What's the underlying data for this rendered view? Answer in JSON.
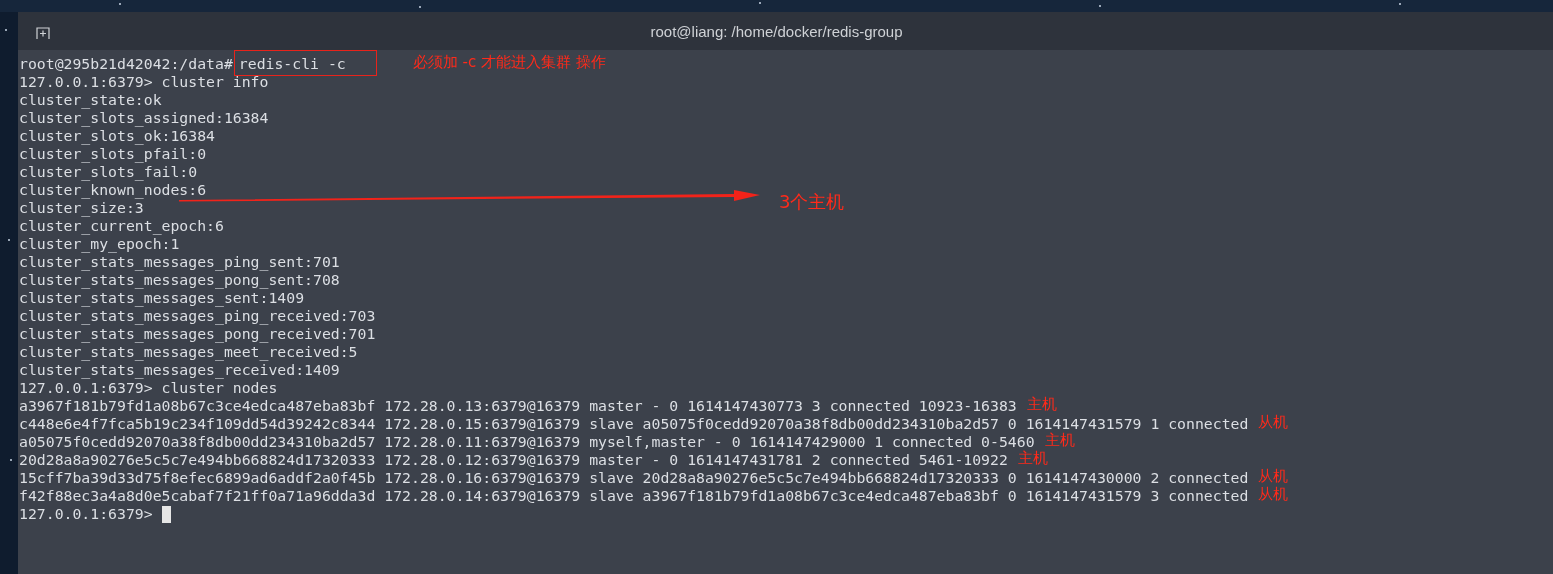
{
  "window": {
    "title": "root@liang: /home/docker/redis-group"
  },
  "lines": [
    {
      "kind": "command",
      "prompt": "root@295b21d42042:/data#",
      "command": "redis-cli -c",
      "highlighted": true,
      "note": "必须加 -c 才能进入集群 操作"
    },
    {
      "kind": "text",
      "text": "127.0.0.1:6379> cluster info"
    },
    {
      "kind": "text",
      "text": "cluster_state:ok"
    },
    {
      "kind": "text",
      "text": "cluster_slots_assigned:16384"
    },
    {
      "kind": "text",
      "text": "cluster_slots_ok:16384"
    },
    {
      "kind": "text",
      "text": "cluster_slots_pfail:0"
    },
    {
      "kind": "text",
      "text": "cluster_slots_fail:0"
    },
    {
      "kind": "text",
      "text": "cluster_known_nodes:6",
      "arrow_note": "3个主机"
    },
    {
      "kind": "text",
      "text": "cluster_size:3"
    },
    {
      "kind": "text",
      "text": "cluster_current_epoch:6"
    },
    {
      "kind": "text",
      "text": "cluster_my_epoch:1"
    },
    {
      "kind": "text",
      "text": "cluster_stats_messages_ping_sent:701"
    },
    {
      "kind": "text",
      "text": "cluster_stats_messages_pong_sent:708"
    },
    {
      "kind": "text",
      "text": "cluster_stats_messages_sent:1409"
    },
    {
      "kind": "text",
      "text": "cluster_stats_messages_ping_received:703"
    },
    {
      "kind": "text",
      "text": "cluster_stats_messages_pong_received:701"
    },
    {
      "kind": "text",
      "text": "cluster_stats_messages_meet_received:5"
    },
    {
      "kind": "text",
      "text": "cluster_stats_messages_received:1409"
    },
    {
      "kind": "text",
      "text": "127.0.0.1:6379> cluster nodes"
    },
    {
      "kind": "text",
      "text": "a3967f181b79fd1a08b67c3ce4edca487eba83bf 172.28.0.13:6379@16379 master - 0 1614147430773 3 connected 10923-16383",
      "note": "主机"
    },
    {
      "kind": "text",
      "text": "c448e6e4f7fca5b19c234f109dd54d39242c8344 172.28.0.15:6379@16379 slave a05075f0cedd92070a38f8db00dd234310ba2d57 0 1614147431579 1 connected",
      "note": "从机"
    },
    {
      "kind": "text",
      "text": "a05075f0cedd92070a38f8db00dd234310ba2d57 172.28.0.11:6379@16379 myself,master - 0 1614147429000 1 connected 0-5460",
      "note": "主机"
    },
    {
      "kind": "text",
      "text": "20d28a8a90276e5c5c7e494bb668824d17320333 172.28.0.12:6379@16379 master - 0 1614147431781 2 connected 5461-10922",
      "note": "主机"
    },
    {
      "kind": "text",
      "text": "15cff7ba39d33d75f8efec6899ad6addf2a0f45b 172.28.0.16:6379@16379 slave 20d28a8a90276e5c5c7e494bb668824d17320333 0 1614147430000 2 connected",
      "note": "从机"
    },
    {
      "kind": "text",
      "text": "f42f88ec3a4a8d0e5cabaf7f21ff0a71a96dda3d 172.28.0.14:6379@16379 slave a3967f181b79fd1a08b67c3ce4edca487eba83bf 0 1614147431579 3 connected",
      "note": "从机"
    },
    {
      "kind": "prompt",
      "text": "127.0.0.1:6379>",
      "cursor": true
    }
  ]
}
